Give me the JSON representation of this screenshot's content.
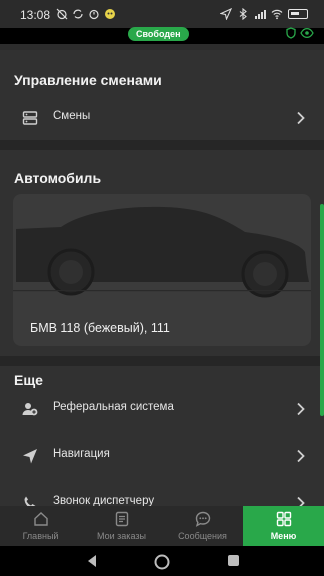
{
  "status_bar": {
    "time": "13:08",
    "battery_level": "80"
  },
  "driver_status": "Свободен",
  "shifts_section": {
    "title": "Управление сменами",
    "items": [
      {
        "label": "Смены",
        "icon": "server-stack-icon"
      }
    ]
  },
  "car_section": {
    "title": "Автомобиль",
    "car_name": "БМВ 118 (бежевый), 111"
  },
  "more_section": {
    "title": "Еще",
    "items": [
      {
        "label": "Реферальная система",
        "icon": "add-person-icon"
      },
      {
        "label": "Навигация",
        "icon": "navigation-arrow-icon"
      },
      {
        "label": "Звонок диспетчеру",
        "icon": "phone-icon"
      }
    ]
  },
  "tabs": [
    {
      "label": "Главный",
      "icon": "home-icon"
    },
    {
      "label": "Мои заказы",
      "icon": "orders-icon"
    },
    {
      "label": "Сообщения",
      "icon": "chat-icon"
    },
    {
      "label": "Меню",
      "icon": "grid-icon",
      "active": true
    }
  ],
  "colors": {
    "accent": "#29a84a",
    "background": "#2c2c2c",
    "section": "#313131"
  }
}
